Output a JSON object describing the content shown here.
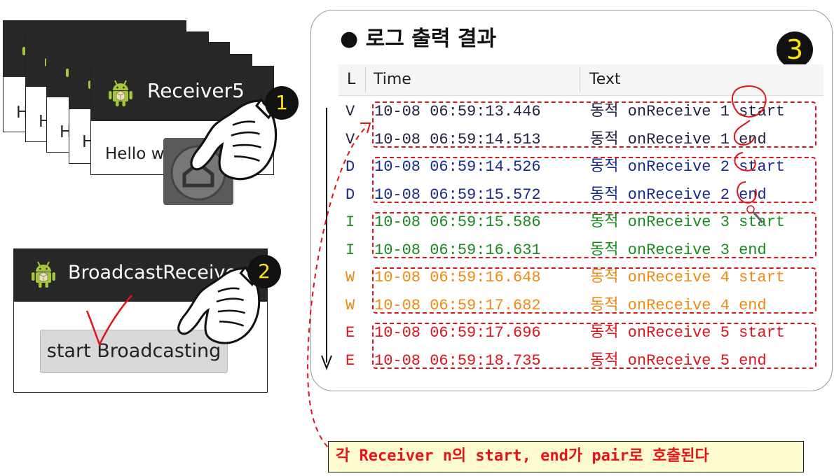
{
  "receivers": {
    "title": "Receiver",
    "number": "5",
    "hello_text": "Hello w",
    "stack_partial": [
      "H",
      "H",
      "H",
      "H"
    ]
  },
  "broadcast_app": {
    "title": "BroadcastReceiver",
    "button_label": "start Broadcasting"
  },
  "steps": {
    "one": "1",
    "two": "2",
    "three": "3"
  },
  "log_panel": {
    "title": "● 로그 출력 결과",
    "columns": {
      "level": "L",
      "time": "Time",
      "text": "Text"
    },
    "rows": [
      {
        "level": "V",
        "time": "10-08 06:59:13.446",
        "text": "동적 onReceive 1 start",
        "color": "#222244"
      },
      {
        "level": "V",
        "time": "10-08 06:59:14.513",
        "text": "동적 onReceive 1 end",
        "color": "#222244"
      },
      {
        "level": "D",
        "time": "10-08 06:59:14.526",
        "text": "동적 onReceive 2 start",
        "color": "#1a2a8a"
      },
      {
        "level": "D",
        "time": "10-08 06:59:15.572",
        "text": "동적 onReceive 2 end",
        "color": "#1a2a8a"
      },
      {
        "level": "I",
        "time": "10-08 06:59:15.586",
        "text": "동적 onReceive 3 start",
        "color": "#198a1c"
      },
      {
        "level": "I",
        "time": "10-08 06:59:16.631",
        "text": "동적 onReceive 3 end",
        "color": "#198a1c"
      },
      {
        "level": "W",
        "time": "10-08 06:59:16.648",
        "text": "동적 onReceive 4 start",
        "color": "#f08a10"
      },
      {
        "level": "W",
        "time": "10-08 06:59:17.682",
        "text": "동적 onReceive 4 end",
        "color": "#f08a10"
      },
      {
        "level": "E",
        "time": "10-08 06:59:17.696",
        "text": "동적 onReceive 5 start",
        "color": "#e0141a"
      },
      {
        "level": "E",
        "time": "10-08 06:59:18.735",
        "text": "동적 onReceive 5 end",
        "color": "#e0141a"
      }
    ]
  },
  "note": "각 Receiver n의 start, end가 pair로 호출된다",
  "colors": {
    "highlight_red": "#e0141a",
    "badge_yellow": "#ffe600",
    "title_bar": "#272727"
  }
}
